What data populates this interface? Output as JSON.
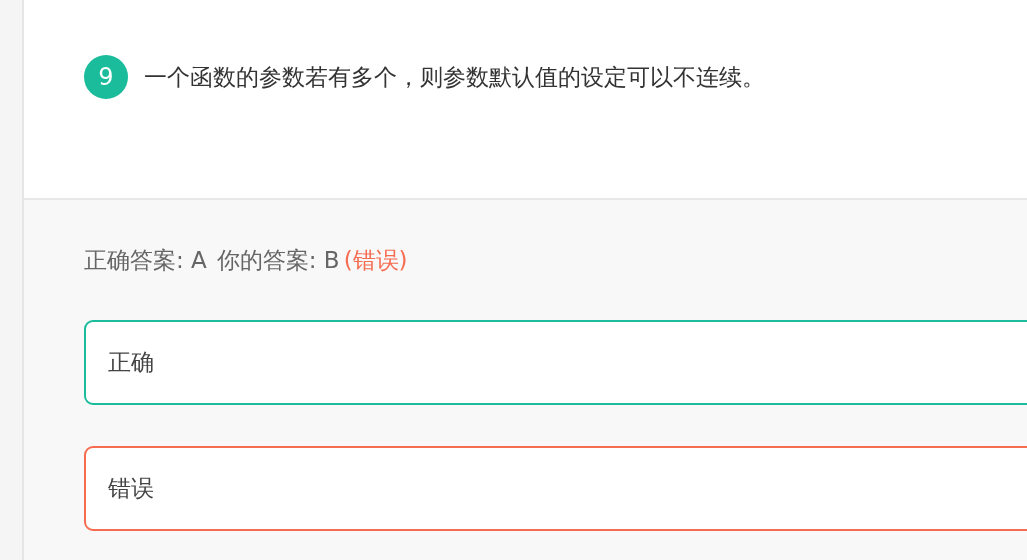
{
  "question": {
    "number": "9",
    "text": "一个函数的参数若有多个，则参数默认值的设定可以不连续。"
  },
  "answer": {
    "correct": "正确答案: A",
    "yours": "你的答案: B",
    "verdict": "(错误)"
  },
  "options": [
    {
      "label": "正确",
      "correct": true,
      "selected": false
    },
    {
      "label": "错误",
      "correct": false,
      "selected": true
    }
  ]
}
